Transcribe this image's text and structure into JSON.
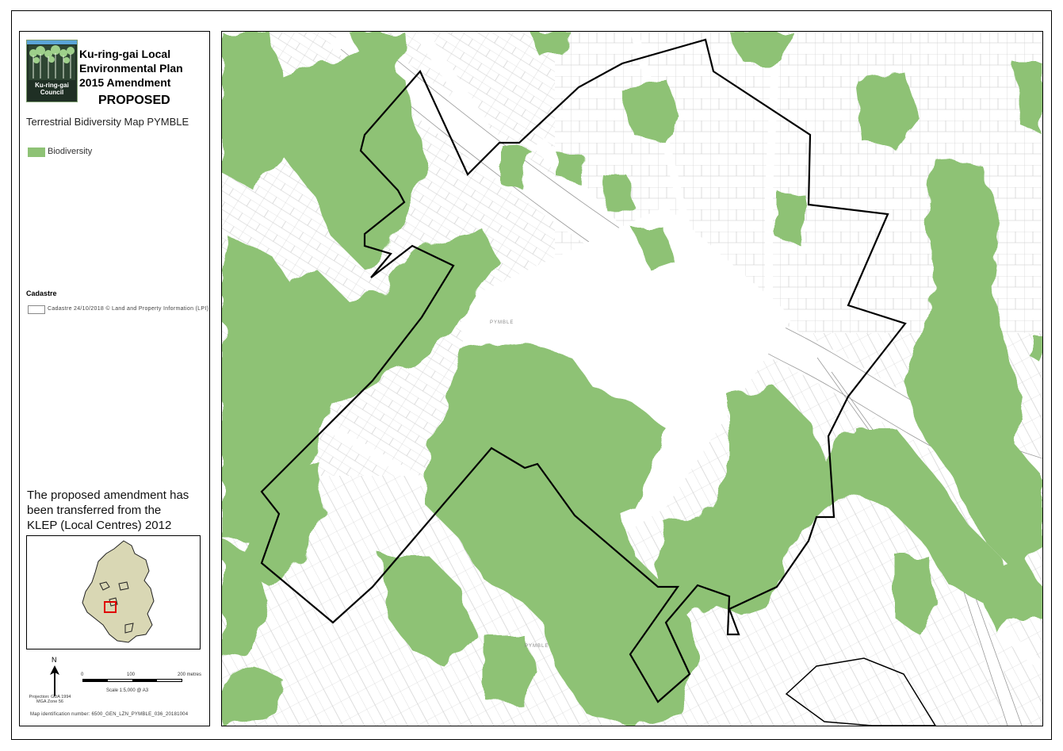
{
  "council": {
    "logo_line1": "Ku-ring-gai",
    "logo_line2": "Council",
    "title_line1": "Ku-ring-gai Local",
    "title_line2": "Environmental Plan",
    "title_line3": "2015 Amendment",
    "status": "PROPOSED"
  },
  "map_name": "Terrestrial Bidiversity Map PYMBLE",
  "legend": {
    "biodiversity_label": "Biodiversity",
    "biodiversity_color": "#8ec275",
    "cadastre_heading": "Cadastre",
    "cadastre_label": "Cadastre 24/10/2018 © Land and Property Information (LPI)"
  },
  "note": {
    "line1": "The proposed amendment has",
    "line2": "been transferred from the",
    "line3": "KLEP (Local Centres) 2012"
  },
  "north_label": "N",
  "projection_line1": "Projection: GDA 1994",
  "projection_line2": "MGA Zone 56",
  "scale": {
    "tick0": "0",
    "tick1": "100",
    "tick2": "200 metres",
    "ratio": "Scale 1:5,000 @ A3"
  },
  "map_id": "Map identification number: 6500_GEN_LZN_PYMBLE_036_20181004",
  "map_labels": {
    "pymble_center": "PYMBLE",
    "pymble_south": "PYMBLE"
  },
  "colors": {
    "boundary": "#000000",
    "cadastre": "#b8b8b8",
    "biodiversity": "#8ec275",
    "inset_fill": "#d9d7b4",
    "inset_highlight": "#e00000"
  }
}
